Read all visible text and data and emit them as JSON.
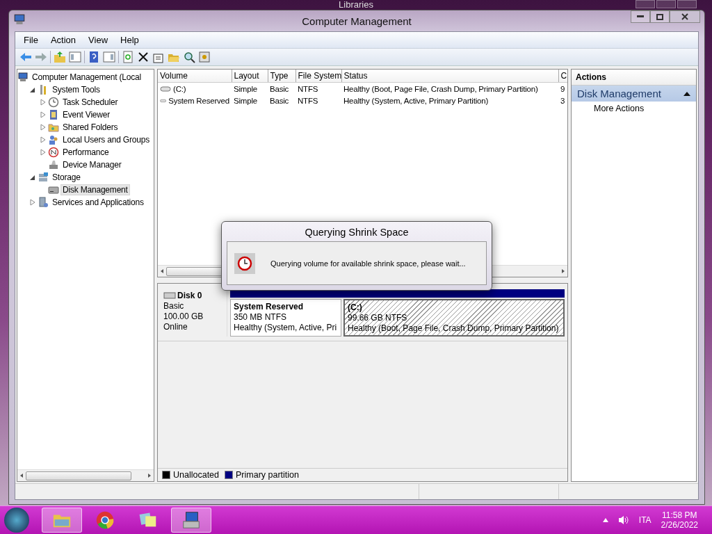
{
  "background_window": {
    "title": "Libraries"
  },
  "window": {
    "title": "Computer Management"
  },
  "menu": [
    "File",
    "Action",
    "View",
    "Help"
  ],
  "tree": [
    {
      "label": "Computer Management (Local",
      "selected": false,
      "children": [
        {
          "label": "System Tools",
          "selected": false,
          "expanded": true,
          "children": [
            {
              "label": "Task Scheduler",
              "selected": false,
              "expanded": false
            },
            {
              "label": "Event Viewer",
              "selected": false,
              "expanded": false
            },
            {
              "label": "Shared Folders",
              "selected": false,
              "expanded": false
            },
            {
              "label": "Local Users and Groups",
              "selected": false,
              "expanded": false
            },
            {
              "label": "Performance",
              "selected": false,
              "expanded": false
            },
            {
              "label": "Device Manager",
              "selected": false
            }
          ]
        },
        {
          "label": "Storage",
          "selected": false,
          "expanded": true,
          "children": [
            {
              "label": "Disk Management",
              "selected": true
            }
          ]
        },
        {
          "label": "Services and Applications",
          "selected": false,
          "expanded": false
        }
      ]
    }
  ],
  "volume_table": {
    "columns": [
      "Volume",
      "Layout",
      "Type",
      "File System",
      "Status",
      "C"
    ],
    "rows": [
      [
        "(C:)",
        "Simple",
        "Basic",
        "NTFS",
        "Healthy (Boot, Page File, Crash Dump, Primary Partition)",
        "9"
      ],
      [
        "System Reserved",
        "Simple",
        "Basic",
        "NTFS",
        "Healthy (System, Active, Primary Partition)",
        "3"
      ]
    ]
  },
  "disk": {
    "name": "Disk 0",
    "type": "Basic",
    "size": "100.00 GB",
    "status": "Online",
    "partitions": [
      {
        "name": "System Reserved",
        "size": "350 MB NTFS",
        "status": "Healthy (System, Active, Pri",
        "selected": false
      },
      {
        "name": "(C:)",
        "size": "99.66 GB NTFS",
        "status": "Healthy (Boot, Page File, Crash Dump, Primary Partition)",
        "selected": true
      }
    ]
  },
  "legend": [
    {
      "label": "Unallocated",
      "color": "#000000"
    },
    {
      "label": "Primary partition",
      "color": "#000080"
    }
  ],
  "actions": {
    "title": "Actions",
    "section": "Disk Management",
    "items": [
      "More Actions"
    ]
  },
  "dialog": {
    "title": "Querying Shrink Space",
    "message": "Querying volume for available shrink space, please wait..."
  },
  "taskbar": {
    "apps": [
      {
        "kind": "explorer",
        "running": true
      },
      {
        "kind": "chrome",
        "running": false
      },
      {
        "kind": "notes",
        "running": false
      },
      {
        "kind": "computer",
        "running": true
      }
    ],
    "language": "ITA",
    "time": "11:58 PM",
    "date": "2/26/2022"
  }
}
